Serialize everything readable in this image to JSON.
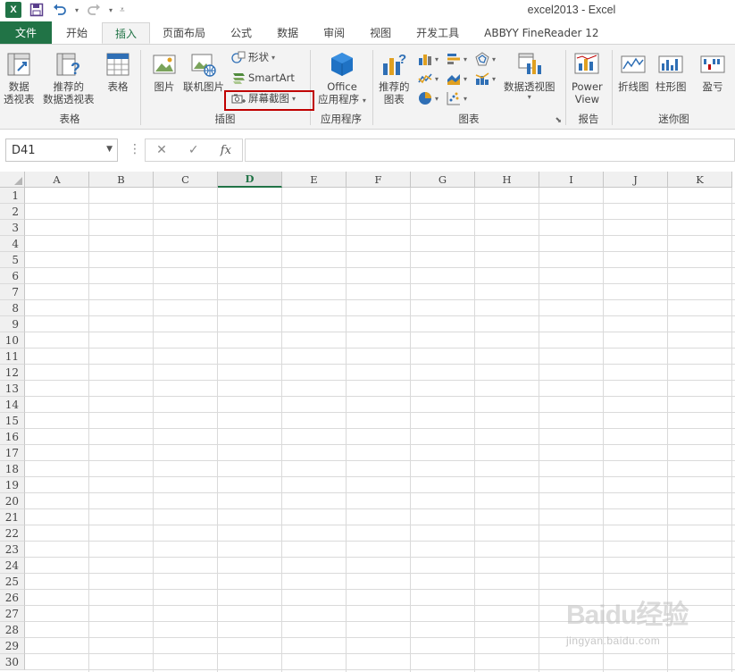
{
  "window": {
    "title": "excel2013 - Excel"
  },
  "qat": {
    "logo_letter": "X"
  },
  "tabs": [
    {
      "label": "文件",
      "kind": "file"
    },
    {
      "label": "开始"
    },
    {
      "label": "插入",
      "active": true
    },
    {
      "label": "页面布局"
    },
    {
      "label": "公式"
    },
    {
      "label": "数据"
    },
    {
      "label": "审阅"
    },
    {
      "label": "视图"
    },
    {
      "label": "开发工具"
    },
    {
      "label": "ABBYY FineReader 12"
    }
  ],
  "ribbon": {
    "tables_group": {
      "label": "表格",
      "pivot_line1": "数据",
      "pivot_line2": "透视表",
      "recommended_line1": "推荐的",
      "recommended_line2": "数据透视表",
      "table": "表格"
    },
    "illustrations_group": {
      "label": "插图",
      "pictures": "图片",
      "online_pictures": "联机图片",
      "shapes": "形状",
      "smartart": "SmartArt",
      "screenshot": "屏幕截图"
    },
    "apps_group": {
      "label": "应用程序",
      "office_line1": "Office",
      "office_line2": "应用程序"
    },
    "charts_group": {
      "label": "图表",
      "recommended_line1": "推荐的",
      "recommended_line2": "图表",
      "pivot_chart": "数据透视图"
    },
    "reports_group": {
      "label": "报告",
      "power_line1": "Power",
      "power_line2": "View"
    },
    "sparklines_group": {
      "label": "迷你图",
      "line": "折线图",
      "column": "柱形图",
      "winloss": "盈亏"
    }
  },
  "formula_bar": {
    "name_box": "D41",
    "fx_label": "fx",
    "formula": ""
  },
  "sheet": {
    "selected_column": "D",
    "columns": [
      "A",
      "B",
      "C",
      "D",
      "E",
      "F",
      "G",
      "H",
      "I",
      "J",
      "K"
    ],
    "rows": [
      "1",
      "2",
      "3",
      "4",
      "5",
      "6",
      "7",
      "8",
      "9",
      "10",
      "11",
      "12",
      "13",
      "14",
      "15",
      "16",
      "17",
      "18",
      "19",
      "20",
      "21",
      "22",
      "23",
      "24",
      "25",
      "26",
      "27",
      "28",
      "29",
      "30"
    ]
  },
  "watermark": {
    "main": "Baidu经验",
    "sub": "jingyan.baidu.com"
  },
  "colors": {
    "accent": "#217346",
    "highlight": "#c00000"
  }
}
